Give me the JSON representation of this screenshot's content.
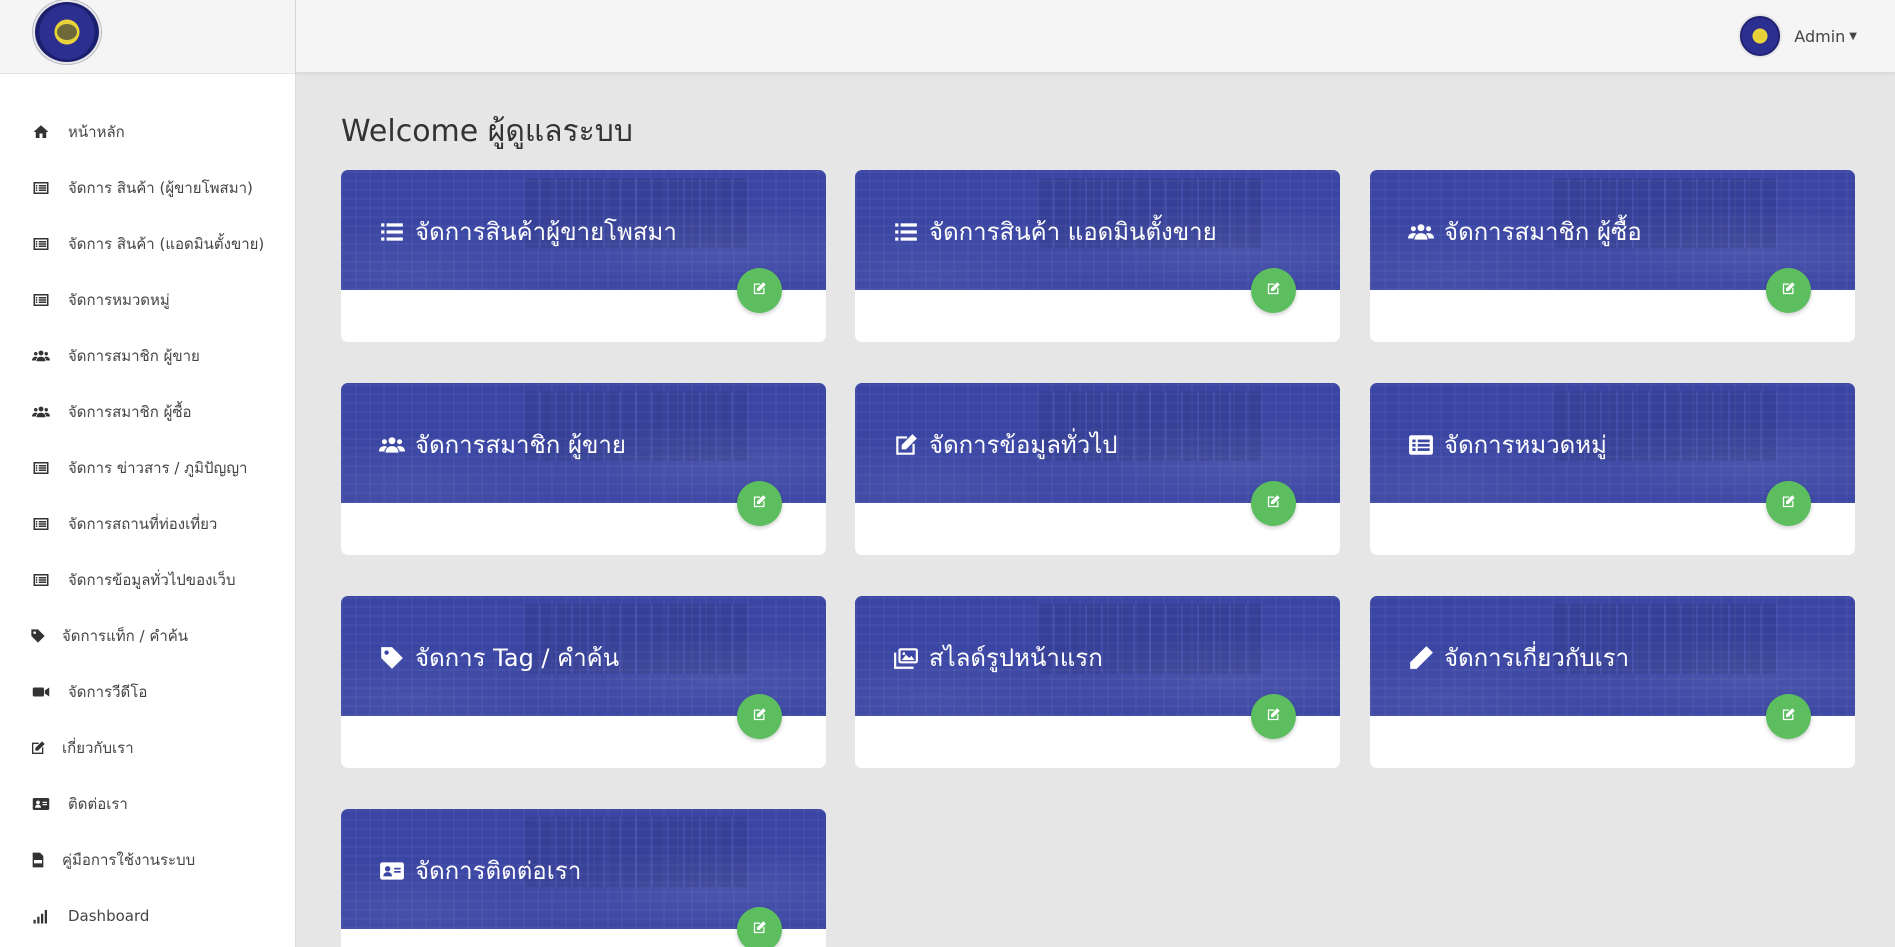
{
  "sidebar": {
    "logo_alt": "logo",
    "items": [
      {
        "label": "หน้าหลัก",
        "icon": "home-icon"
      },
      {
        "label": "จัดการ สินค้า (ผู้ขายโพสมา)",
        "icon": "list-icon"
      },
      {
        "label": "จัดการ สินค้า (แอดมินตั้งขาย)",
        "icon": "list-icon"
      },
      {
        "label": "จัดการหมวดหมู่",
        "icon": "list-icon"
      },
      {
        "label": "จัดการสมาชิก ผู้ขาย",
        "icon": "users-icon"
      },
      {
        "label": "จัดการสมาชิก ผู้ซื้อ",
        "icon": "users-icon"
      },
      {
        "label": "จัดการ ข่าวสาร / ภูมิปัญญา",
        "icon": "list-icon"
      },
      {
        "label": "จัดการสถานที่ท่องเที่ยว",
        "icon": "list-icon"
      },
      {
        "label": "จัดการข้อมูลทั่วไปของเว็บ",
        "icon": "list-icon"
      },
      {
        "label": "จัดการแท็ก / คำค้น",
        "icon": "tag-icon"
      },
      {
        "label": "จัดการวีดีโอ",
        "icon": "video-icon"
      },
      {
        "label": "เกี่ยวกับเรา",
        "icon": "edit-icon"
      },
      {
        "label": "ติดต่อเรา",
        "icon": "contact-card-icon"
      },
      {
        "label": "คู่มือการใช้งานระบบ",
        "icon": "pdf-file-icon"
      },
      {
        "label": "Dashboard",
        "icon": "signal-bars-icon"
      }
    ]
  },
  "topbar": {
    "user_name": "Admin"
  },
  "main": {
    "title": "Welcome ผู้ดูแลระบบ",
    "cards": [
      {
        "label": "จัดการสินค้าผู้ขายโพสมา",
        "icon": "list-icon"
      },
      {
        "label": "จัดการสินค้า แอดมินตั้งขาย",
        "icon": "list-icon"
      },
      {
        "label": "จัดการสมาชิก ผู้ซื้อ",
        "icon": "users-icon"
      },
      {
        "label": "จัดการสมาชิก ผู้ขาย",
        "icon": "users-icon"
      },
      {
        "label": "จัดการข้อมูลทั่วไป",
        "icon": "edit-icon"
      },
      {
        "label": "จัดการหมวดหมู่",
        "icon": "list-alt-icon"
      },
      {
        "label": "จัดการ Tag / คำค้น",
        "icon": "tag-icon"
      },
      {
        "label": "สไลด์รูปหน้าแรก",
        "icon": "images-icon"
      },
      {
        "label": "จัดการเกี่ยวกับเรา",
        "icon": "pencil-icon"
      },
      {
        "label": "จัดการติดต่อเรา",
        "icon": "contact-card-icon"
      }
    ]
  },
  "colors": {
    "card_header": "#3b46a4",
    "edit_button": "#5cbe5f",
    "background": "#e6e6e6"
  }
}
